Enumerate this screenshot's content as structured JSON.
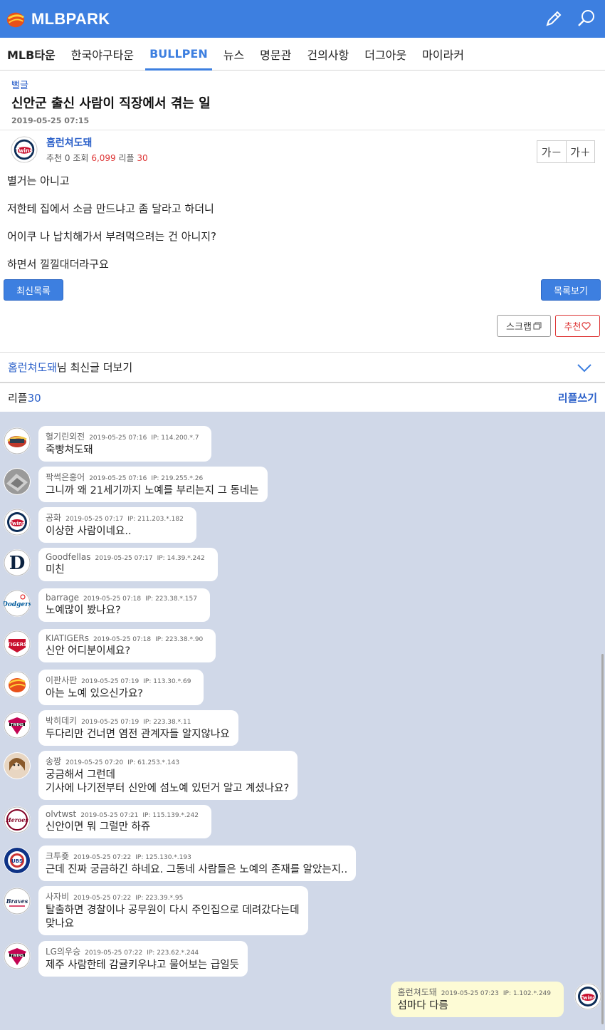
{
  "header": {
    "logo_text": "MLBPARK",
    "brand_color": "#3d7fe0",
    "icons": [
      "pencil-icon",
      "search-icon"
    ]
  },
  "nav": {
    "items": [
      {
        "label": "MLB타운"
      },
      {
        "label": "한국야구타운"
      },
      {
        "label": "BULLPEN"
      },
      {
        "label": "뉴스"
      },
      {
        "label": "명문관"
      },
      {
        "label": "건의사항"
      },
      {
        "label": "더그아웃"
      },
      {
        "label": "마이라커"
      }
    ],
    "active": "BULLPEN"
  },
  "article": {
    "category": "뻘글",
    "title": "신안군 출신 사람이 직장에서 겪는 일",
    "date": "2019-05-25 07:15",
    "author": "홈런쳐도돼",
    "stats": {
      "rec_label": "추천",
      "rec": "0",
      "views_label": "조회",
      "views": "6,099",
      "replies_label": "리플",
      "replies": "30"
    },
    "font_down": "가－",
    "font_up": "가＋",
    "body": [
      "별거는 아니고",
      "저한테 집에서 소금 만드냐고 좀 달라고 하더니",
      "어이쿠 나 납치해가서 부려먹으려는 건 아니지?",
      "하면서 낄낄대더라구요"
    ],
    "btn_latest": "최신목록",
    "btn_list": "목록보기",
    "btn_scrap": "스크랩",
    "btn_recommend": "추천"
  },
  "more": {
    "nick": "홈런쳐도돼",
    "suffix": "님 최신글 더보기"
  },
  "replies": {
    "label": "리플",
    "count": "30",
    "write": "리플쓰기"
  },
  "comments": [
    {
      "nick": "혈기린외전",
      "time": "2019-05-25 07:16",
      "ip": "IP: 114.200.*.7",
      "text": "죽빵쳐도돼",
      "avatar": "logo-ball-icon"
    },
    {
      "nick": "팍썩은홍어",
      "time": "2019-05-25 07:16",
      "ip": "IP: 219.255.*.26",
      "text": "그니까 왜 21세기까지 노예를 부리는지 그 동네는",
      "avatar": "photo-avatar-icon"
    },
    {
      "nick": "공화",
      "time": "2019-05-25 07:17",
      "ip": "IP: 211.203.*.182",
      "text": "이상한 사람이네요..",
      "avatar": "twins-icon"
    },
    {
      "nick": "Goodfellas",
      "time": "2019-05-25 07:17",
      "ip": "IP: 14.39.*.242",
      "text": "미친",
      "avatar": "tigers-d-icon"
    },
    {
      "nick": "barrage",
      "time": "2019-05-25 07:18",
      "ip": "IP: 223.38.*.157",
      "text": "노예많이 봤나요?",
      "avatar": "dodgers-icon"
    },
    {
      "nick": "KIATIGERs",
      "time": "2019-05-25 07:18",
      "ip": "IP: 223.38.*.90",
      "text": "신안 어디분이세요?",
      "avatar": "kia-tigers-icon"
    },
    {
      "nick": "이판사판",
      "time": "2019-05-25 07:19",
      "ip": "IP: 113.30.*.69",
      "text": "아는 노예 있으신가요?",
      "avatar": "logo-ball-icon"
    },
    {
      "nick": "박히데키",
      "time": "2019-05-25 07:19",
      "ip": "IP: 223.38.*.11",
      "text": "두다리만 건너면 염전 관계자들 알지않나요",
      "avatar": "twins-kbo-icon"
    },
    {
      "nick": "송짱",
      "time": "2019-05-25 07:20",
      "ip": "IP: 61.253.*.143",
      "text1": "궁금해서 그런데",
      "text2": "기사에 나기전부터 신안에 섬노예 있던거 알고 계셨나요?",
      "avatar": "photo-avatar-icon"
    },
    {
      "nick": "olvtwst",
      "time": "2019-05-25 07:21",
      "ip": "IP: 115.139.*.242",
      "text": "신안이면 뭐 그럴만 하쥬",
      "avatar": "heroes-icon"
    },
    {
      "nick": "크투죶",
      "time": "2019-05-25 07:22",
      "ip": "IP: 125.130.*.193",
      "text": "근데 진짜 궁금하긴 하네요. 그동네 사람들은 노예의 존재를 알았는지..",
      "avatar": "cubs-icon"
    },
    {
      "nick": "사자비",
      "time": "2019-05-25 07:22",
      "ip": "IP: 223.39.*.95",
      "text1": "탈출하면 경찰이나 공무원이 다시 주인집으로 데려갔다는데",
      "text2": "맞나요",
      "avatar": "braves-icon"
    },
    {
      "nick": "LG의우승",
      "time": "2019-05-25 07:22",
      "ip": "IP: 223.62.*.244",
      "text": "제주 사람한테 감귤키우냐고 물어보는 급일듯",
      "avatar": "twins-kbo-icon"
    }
  ],
  "my_comment": {
    "nick": "홈런쳐도돼",
    "time": "2019-05-25 07:23",
    "ip": "IP: 1.102.*.249",
    "text": "섬마다 다름",
    "avatar": "twins-icon"
  }
}
